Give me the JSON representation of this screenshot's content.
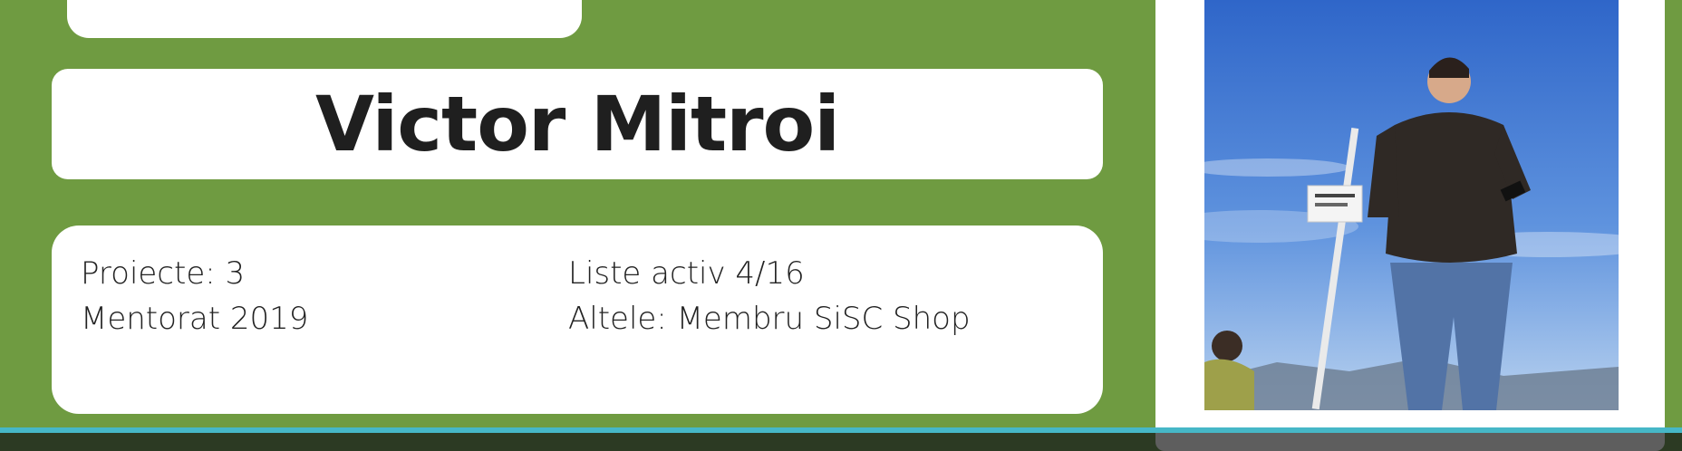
{
  "profile": {
    "name": "Victor Mitroi",
    "info": {
      "left": [
        "Proiecte: 3",
        "Mentorat 2019"
      ],
      "right": [
        "Liste activ 4/16",
        "Altele: Membru SiSC Shop"
      ]
    }
  },
  "colors": {
    "background_green": "#6f9b41",
    "card_white": "#ffffff",
    "text_dark": "#1f1f1f",
    "accent_cyan": "#46b7c7",
    "bottom_bar": "#2c3a23"
  }
}
